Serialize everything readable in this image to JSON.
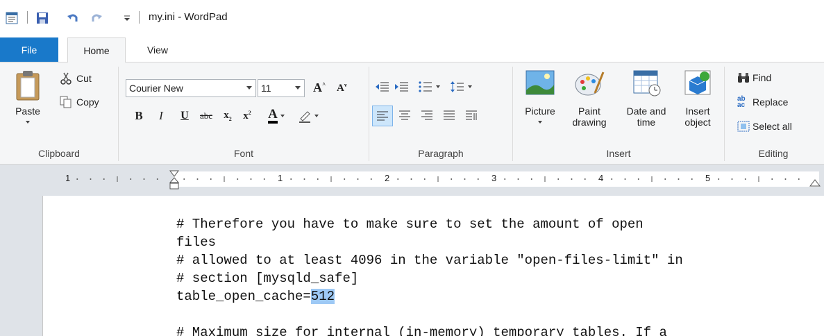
{
  "window": {
    "title": "my.ini - WordPad"
  },
  "tabs": {
    "file": "File",
    "home": "Home",
    "view": "View"
  },
  "clipboard": {
    "group_label": "Clipboard",
    "paste": "Paste",
    "cut": "Cut",
    "copy": "Copy"
  },
  "font": {
    "group_label": "Font",
    "family": "Courier New",
    "size": "11"
  },
  "paragraph": {
    "group_label": "Paragraph"
  },
  "insert": {
    "group_label": "Insert",
    "picture": "Picture",
    "paint_line1": "Paint",
    "paint_line2": "drawing",
    "datetime_line1": "Date and",
    "datetime_line2": "time",
    "object_line1": "Insert",
    "object_line2": "object"
  },
  "editing": {
    "group_label": "Editing",
    "find": "Find",
    "replace": "Replace",
    "select_all": "Select all"
  },
  "ruler": {
    "numbers": [
      "1",
      "1",
      "2",
      "3",
      "4",
      "5"
    ]
  },
  "document": {
    "lines": [
      "# Therefore you have to make sure to set the amount of open",
      "files",
      "# allowed to at least 4096 in the variable \"open-files-limit\" in",
      "# section [mysqld_safe]"
    ],
    "cache_prefix": "table_open_cache=",
    "cache_value": "512",
    "partial_line": "# Maximum size for internal (in-memory) temporary tables. If a"
  },
  "colors": {
    "accent": "#1979ca",
    "selection": "#9ec9f5",
    "ribbon_bg": "#f5f6f7"
  }
}
